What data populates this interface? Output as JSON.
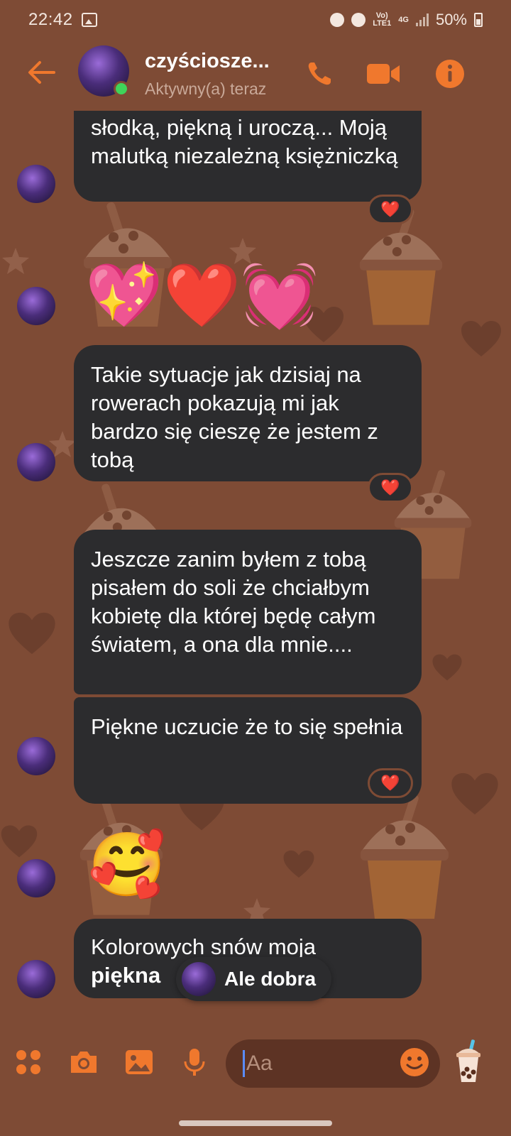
{
  "status_bar": {
    "time": "22:42",
    "network_top": "Vo)",
    "network_bottom": "LTE1",
    "network_type": "4G",
    "battery": "50%"
  },
  "header": {
    "contact_name": "czyściosze...",
    "contact_status": "Aktywny(a) teraz"
  },
  "messages": [
    {
      "id": "m1",
      "text": "słodką, piękną i uroczą... Moją malutką niezależną księżniczką",
      "reaction": "❤️"
    },
    {
      "id": "m2",
      "emoji": "💖❤️💓"
    },
    {
      "id": "m3",
      "text": "Takie sytuacje jak dzisiaj na rowerach pokazują mi jak bardzo się cieszę że jestem z tobą",
      "reaction": "❤️"
    },
    {
      "id": "m4",
      "text": "Jeszcze zanim byłem z tobą pisałem do soli że chciałbym kobietę dla której będę całym światem, a ona dla mnie...."
    },
    {
      "id": "m5",
      "text": "Piękne uczucie że to się spełnia",
      "reaction": "❤️"
    },
    {
      "id": "m6",
      "emoji": "🥰"
    },
    {
      "id": "m7",
      "text_line1": "Kolorowych snów moja",
      "text_line2": "piękna"
    }
  ],
  "typing_toast": {
    "text": "Ale dobra"
  },
  "composer": {
    "placeholder": "Aa"
  },
  "colors": {
    "background": "#7e4b35",
    "bubble": "#2c2c2e",
    "accent": "#f0782d",
    "online": "#3fd45a"
  },
  "icons": [
    "back-arrow-icon",
    "phone-icon",
    "video-icon",
    "info-icon",
    "menu-dots-icon",
    "camera-icon",
    "gallery-icon",
    "microphone-icon",
    "emoji-icon",
    "bubble-tea-icon"
  ]
}
